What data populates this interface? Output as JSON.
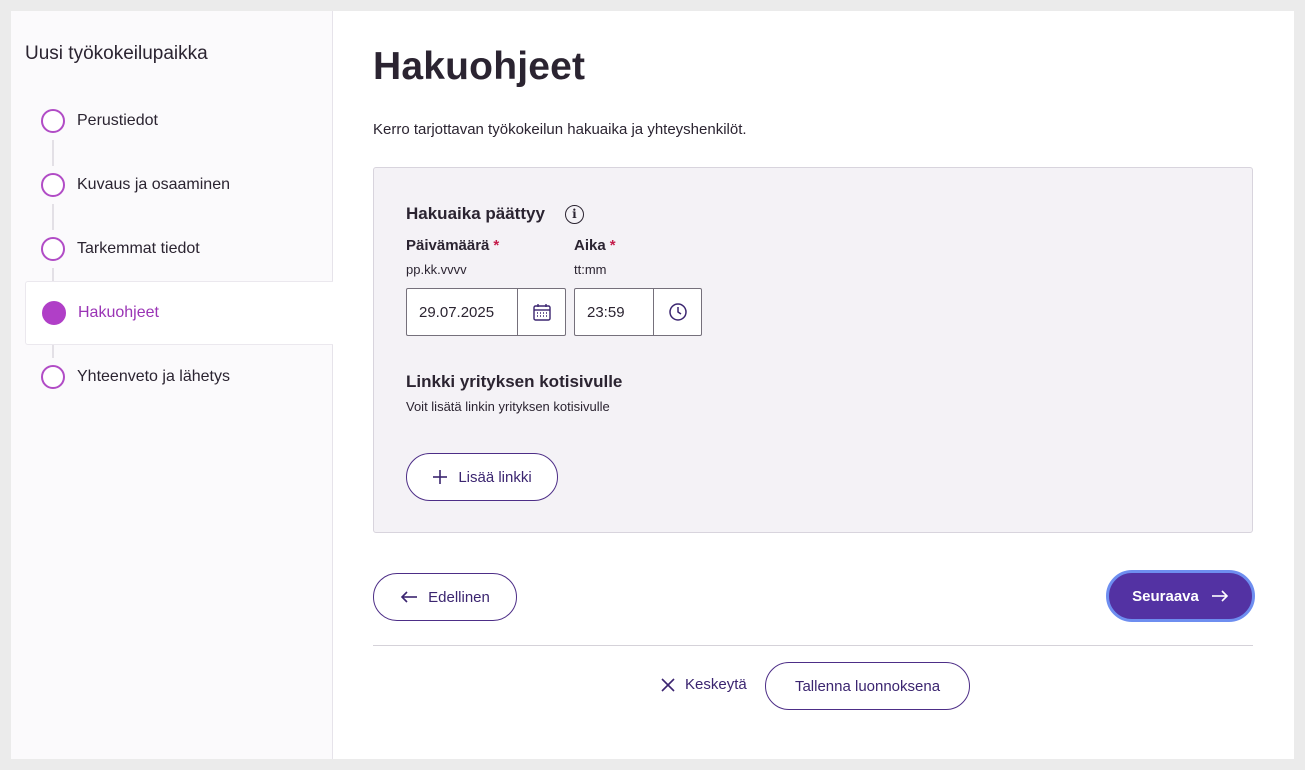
{
  "sidebar": {
    "title": "Uusi työkokeilupaikka",
    "steps": [
      {
        "label": "Perustiedot"
      },
      {
        "label": "Kuvaus ja osaaminen"
      },
      {
        "label": "Tarkemmat tiedot"
      },
      {
        "label": "Hakuohjeet",
        "active": true
      },
      {
        "label": "Yhteenveto ja lähetys"
      }
    ]
  },
  "main": {
    "title": "Hakuohjeet",
    "intro": "Kerro tarjottavan työkokeilun hakuaika ja yhteyshenkilöt.",
    "deadline": {
      "heading": "Hakuaika päättyy",
      "date_label": "Päivämäärä",
      "date_hint": "pp.kk.vvvv",
      "date_value": "29.07.2025",
      "time_label": "Aika",
      "time_hint": "tt:mm",
      "time_value": "23:59",
      "required_mark": "*"
    },
    "link_section": {
      "heading": "Linkki yrityksen kotisivulle",
      "description": "Voit lisätä linkin yrityksen kotisivulle",
      "add_button": "Lisää linkki"
    },
    "nav": {
      "prev": "Edellinen",
      "next": "Seuraava"
    },
    "footer": {
      "cancel": "Keskeytä",
      "save_draft": "Tallenna luonnoksena"
    }
  },
  "colors": {
    "accent": "#b03fc7",
    "primary": "#5332a3",
    "text": "#2b2431",
    "required": "#c41c4a"
  },
  "icons": {
    "date": "calendar-icon",
    "time": "clock-icon",
    "info": "info-icon",
    "add": "plus-icon",
    "prev": "arrow-left-icon",
    "next": "arrow-right-icon",
    "cancel": "close-icon"
  }
}
